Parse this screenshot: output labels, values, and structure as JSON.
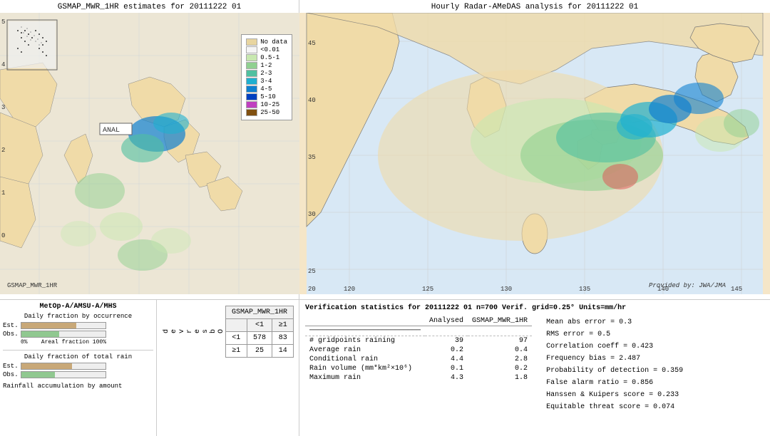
{
  "left_title": "GSMAP_MWR_1HR estimates for 20111222 01",
  "right_title": "Hourly Radar-AMeDAS analysis for 20111222 01",
  "legend": {
    "items": [
      {
        "label": "No data",
        "color": "#e8d5a0"
      },
      {
        "label": "<0.01",
        "color": "#f5f5f5"
      },
      {
        "label": "0.5-1",
        "color": "#c8e8b0"
      },
      {
        "label": "1-2",
        "color": "#90d090"
      },
      {
        "label": "2-3",
        "color": "#50c0a0"
      },
      {
        "label": "3-4",
        "color": "#20b0d0"
      },
      {
        "label": "4-5",
        "color": "#1080d0"
      },
      {
        "label": "5-10",
        "color": "#0040c0"
      },
      {
        "label": "10-25",
        "color": "#c040c0"
      },
      {
        "label": "25-50",
        "color": "#805010"
      }
    ]
  },
  "left_axis_labels": [
    "5",
    "4",
    "3",
    "2",
    "1",
    "0"
  ],
  "right_axis_labels_lat": [
    "45",
    "40",
    "35",
    "30",
    "25",
    "20"
  ],
  "right_axis_labels_lon": [
    "120",
    "125",
    "130",
    "135",
    "140",
    "145"
  ],
  "bottom_left": {
    "source_label": "MetOp-A/AMSU-A/MHS",
    "chart1_title": "Daily fraction by occurrence",
    "chart1_est_pct": 65,
    "chart1_obs_pct": 45,
    "chart1_est_label": "Est.",
    "chart1_obs_label": "Obs.",
    "axis_left": "0%",
    "axis_right": "Areal fraction 100%",
    "chart2_title": "Daily fraction of total rain",
    "chart2_est_pct": 60,
    "chart2_obs_pct": 40,
    "chart2_est_label": "Est.",
    "chart2_obs_label": "Obs.",
    "footer": "Rainfall accumulation by amount"
  },
  "bottom_center": {
    "table_title": "GSMAP_MWR_1HR",
    "col1": "<1",
    "col2": "≥1",
    "row_label1": "<1",
    "row_label2": "≥1",
    "cell_11": "578",
    "cell_12": "83",
    "cell_21": "25",
    "cell_22": "14",
    "observed_label": "O\nb\ns\ne\nr\nv\ne\nd"
  },
  "verification": {
    "title": "Verification statistics for 20111222 01  n=700  Verif. grid=0.25°  Units=mm/hr",
    "col_analysed": "Analysed",
    "col_gsmap": "GSMAP_MWR_1HR",
    "rows": [
      {
        "label": "# gridpoints raining",
        "analysed": "39",
        "gsmap": "97"
      },
      {
        "label": "Average rain",
        "analysed": "0.2",
        "gsmap": "0.4"
      },
      {
        "label": "Conditional rain",
        "analysed": "4.4",
        "gsmap": "2.8"
      },
      {
        "label": "Rain volume (mm*km²×10⁶)",
        "analysed": "0.1",
        "gsmap": "0.2"
      },
      {
        "label": "Maximum rain",
        "analysed": "4.3",
        "gsmap": "1.8"
      }
    ],
    "stats": [
      "Mean abs error = 0.3",
      "RMS error = 0.5",
      "Correlation coeff = 0.423",
      "Frequency bias = 2.487",
      "Probability of detection = 0.359",
      "False alarm ratio = 0.856",
      "Hanssen & Kuipers score = 0.233",
      "Equitable threat score = 0.074"
    ]
  },
  "map_credit": "Provided by: JWA/JMA"
}
